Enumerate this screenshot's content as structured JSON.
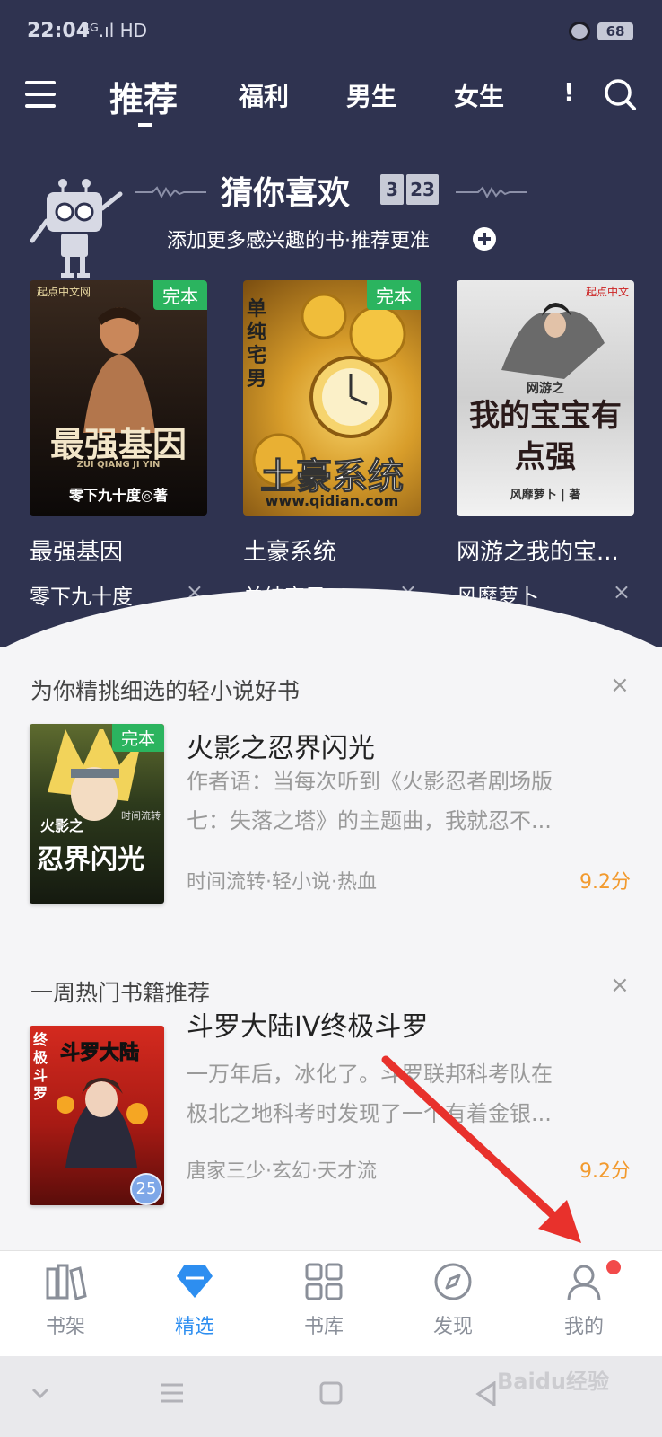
{
  "status_bar": {
    "time": "22:04",
    "network": "⁴ᴳ.ıl HD",
    "battery": "68"
  },
  "nav": {
    "tabs": [
      "推荐",
      "福利",
      "男生",
      "女生",
      "!"
    ],
    "active": "推荐"
  },
  "guess": {
    "title": "猜你喜欢",
    "date_month": "3",
    "date_day": "23",
    "subtitle": "添加更多感兴趣的书·推荐更准"
  },
  "books": [
    {
      "title": "最强基因",
      "author": "零下九十度",
      "cover_text": "最强基因",
      "cover_sub": "ZUI QIANG JI YIN",
      "cover_footer": "零下九十度◎著",
      "cover_brand": "起点中文网",
      "badge": "完本"
    },
    {
      "title": "土豪系统",
      "author": "单纯宅男",
      "cover_text": "土豪系统",
      "cover_sub": "单纯宅男",
      "cover_footer": "www.qidian.com",
      "badge": "完本"
    },
    {
      "title": "网游之我的宝...",
      "author": "风靡萝卜",
      "cover_text": "我的宝宝有点强",
      "cover_sub": "网游之",
      "cover_footer": "风靡萝卜 | 著",
      "cover_brand": "起点中文",
      "badge": ""
    }
  ],
  "close_symbol": "×",
  "sections": [
    {
      "title": "为你精挑细选的轻小说好书",
      "book_title": "火影之忍界闪光",
      "desc_line1": "作者语：当每次听到《火影忍者剧场版",
      "desc_line2": "七：失落之塔》的主题曲，我就忍不...",
      "meta": "时间流转·轻小说·热血",
      "score": "9.2分",
      "badge": "完本",
      "cover_text": "忍界闪光",
      "cover_sub": "火影之",
      "cover_side": "时间流转"
    },
    {
      "title": "一周热门书籍推荐",
      "book_title": "斗罗大陆IV终极斗罗",
      "desc_line1": "一万年后，冰化了。斗罗联邦科考队在",
      "desc_line2": "极北之地科考时发现了一个有着金银...",
      "meta": "唐家三少·玄幻·天才流",
      "score": "9.2分",
      "cover_text": "斗罗大陆",
      "cover_side": "终极斗罗",
      "cover_num": "25"
    }
  ],
  "bottom_nav": [
    {
      "label": "书架",
      "icon": "bookshelf-icon"
    },
    {
      "label": "精选",
      "icon": "diamond-icon",
      "active": true
    },
    {
      "label": "书库",
      "icon": "grid-icon"
    },
    {
      "label": "发现",
      "icon": "compass-icon"
    },
    {
      "label": "我的",
      "icon": "user-icon"
    }
  ],
  "watermark": "Baidu经验",
  "colors": {
    "header_bg": "#2f3350",
    "accent": "#2d8ef0",
    "score": "#f29a2e",
    "badge_green": "#2bb45f",
    "annotation_arrow": "#e8312c"
  }
}
